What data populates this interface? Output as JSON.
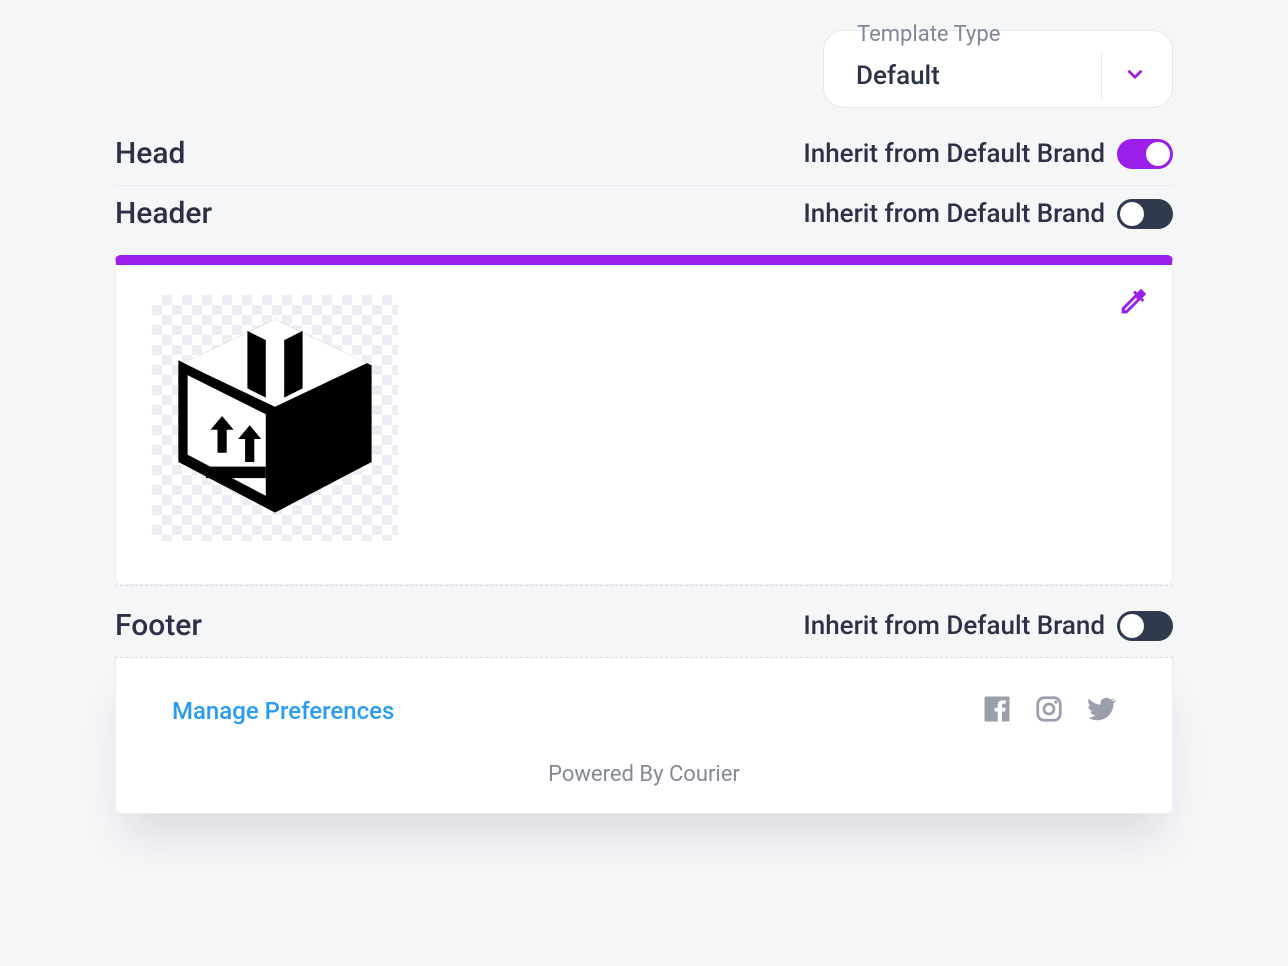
{
  "templateType": {
    "label": "Template Type",
    "value": "Default"
  },
  "sections": {
    "head": {
      "title": "Head",
      "inheritLabel": "Inherit from Default Brand",
      "inheritOn": true
    },
    "header": {
      "title": "Header",
      "inheritLabel": "Inherit from Default Brand",
      "inheritOn": false,
      "accentColor": "#9b1fe8",
      "logoIcon": "package-box-icon"
    },
    "footer": {
      "title": "Footer",
      "inheritLabel": "Inherit from Default Brand",
      "inheritOn": false,
      "managePrefLabel": "Manage Preferences",
      "poweredBy": "Powered By Courier",
      "social": [
        "facebook",
        "instagram",
        "twitter"
      ]
    }
  },
  "colors": {
    "accent": "#9b1fe8",
    "link": "#2a9cf0",
    "textDark": "#2b3247"
  }
}
